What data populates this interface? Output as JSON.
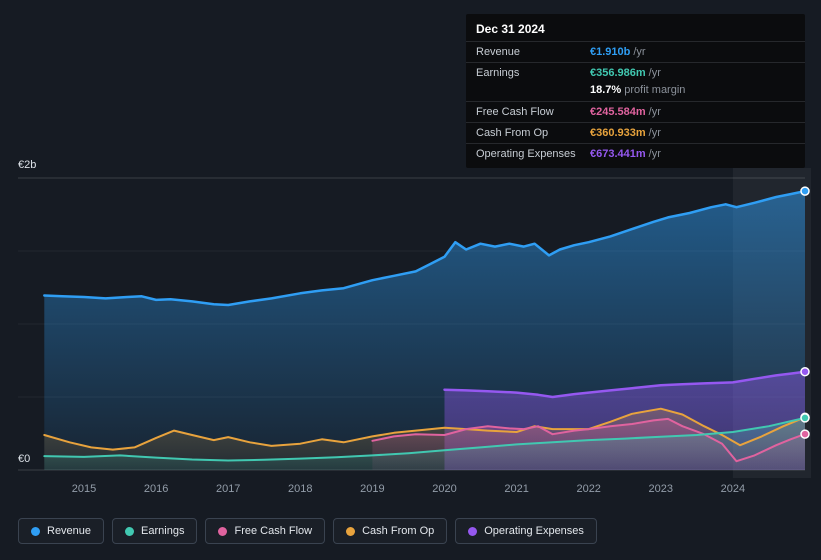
{
  "colors": {
    "revenue": "#2f9ef4",
    "earnings": "#41c8b1",
    "free_cash_flow": "#e0639f",
    "cash_from_op": "#e8a33d",
    "operating_expenses": "#9558f0"
  },
  "tooltip": {
    "title": "Dec 31 2024",
    "rows": [
      {
        "label": "Revenue",
        "value": "€1.910b",
        "unit": "/yr"
      },
      {
        "label": "Earnings",
        "value": "€356.986m",
        "unit": "/yr",
        "sub_bold": "18.7%",
        "sub_text": "profit margin"
      },
      {
        "label": "Free Cash Flow",
        "value": "€245.584m",
        "unit": "/yr"
      },
      {
        "label": "Cash From Op",
        "value": "€360.933m",
        "unit": "/yr"
      },
      {
        "label": "Operating Expenses",
        "value": "€673.441m",
        "unit": "/yr"
      }
    ]
  },
  "legend": {
    "items": [
      {
        "label": "Revenue",
        "color": "revenue"
      },
      {
        "label": "Earnings",
        "color": "earnings"
      },
      {
        "label": "Free Cash Flow",
        "color": "free_cash_flow"
      },
      {
        "label": "Cash From Op",
        "color": "cash_from_op"
      },
      {
        "label": "Operating Expenses",
        "color": "operating_expenses"
      }
    ]
  },
  "chart_data": {
    "type": "area",
    "title": "",
    "x_unit": "year",
    "x_range": [
      2014.45,
      2025.0
    ],
    "y_max": 2.0,
    "y_axis_top_label": "€2b",
    "y_axis_zero_label": "€0",
    "x_ticks": [
      2015,
      2016,
      2017,
      2018,
      2019,
      2020,
      2021,
      2022,
      2023,
      2024
    ],
    "gridlines": [
      0,
      0.5,
      1.0,
      1.5,
      2.0
    ],
    "highlight_from": 2024.0,
    "legend_position": "bottom",
    "series": [
      {
        "name": "Revenue",
        "color": "#2f9ef4",
        "width": 2.5,
        "fill_top": 0.5,
        "fill_bottom": 0.07,
        "points": [
          [
            2014.45,
            1.195
          ],
          [
            2014.7,
            1.19
          ],
          [
            2015,
            1.185
          ],
          [
            2015.3,
            1.175
          ],
          [
            2015.6,
            1.185
          ],
          [
            2015.8,
            1.19
          ],
          [
            2016,
            1.165
          ],
          [
            2016.2,
            1.17
          ],
          [
            2016.5,
            1.155
          ],
          [
            2016.8,
            1.135
          ],
          [
            2017,
            1.13
          ],
          [
            2017.3,
            1.155
          ],
          [
            2017.6,
            1.175
          ],
          [
            2018,
            1.21
          ],
          [
            2018.3,
            1.23
          ],
          [
            2018.6,
            1.245
          ],
          [
            2019,
            1.3
          ],
          [
            2019.3,
            1.33
          ],
          [
            2019.6,
            1.36
          ],
          [
            2019.8,
            1.41
          ],
          [
            2020,
            1.46
          ],
          [
            2020.15,
            1.56
          ],
          [
            2020.3,
            1.51
          ],
          [
            2020.5,
            1.55
          ],
          [
            2020.7,
            1.53
          ],
          [
            2020.9,
            1.55
          ],
          [
            2021.1,
            1.53
          ],
          [
            2021.25,
            1.55
          ],
          [
            2021.45,
            1.47
          ],
          [
            2021.6,
            1.51
          ],
          [
            2021.8,
            1.54
          ],
          [
            2022,
            1.56
          ],
          [
            2022.3,
            1.6
          ],
          [
            2022.6,
            1.65
          ],
          [
            2022.9,
            1.7
          ],
          [
            2023.1,
            1.73
          ],
          [
            2023.4,
            1.76
          ],
          [
            2023.7,
            1.8
          ],
          [
            2023.9,
            1.82
          ],
          [
            2024.05,
            1.8
          ],
          [
            2024.3,
            1.83
          ],
          [
            2024.6,
            1.87
          ],
          [
            2024.8,
            1.89
          ],
          [
            2025,
            1.91
          ]
        ]
      },
      {
        "name": "Operating Expenses",
        "color": "#9558f0",
        "width": 2.5,
        "fill_top": 0.42,
        "fill_bottom": 0.3,
        "points": [
          [
            2020,
            0.55
          ],
          [
            2020.3,
            0.545
          ],
          [
            2020.6,
            0.54
          ],
          [
            2021,
            0.53
          ],
          [
            2021.3,
            0.515
          ],
          [
            2021.5,
            0.5
          ],
          [
            2021.8,
            0.52
          ],
          [
            2022,
            0.53
          ],
          [
            2022.3,
            0.545
          ],
          [
            2022.6,
            0.56
          ],
          [
            2023,
            0.58
          ],
          [
            2023.3,
            0.587
          ],
          [
            2023.6,
            0.593
          ],
          [
            2024,
            0.6
          ],
          [
            2024.3,
            0.625
          ],
          [
            2024.6,
            0.648
          ],
          [
            2024.8,
            0.66
          ],
          [
            2025,
            0.673
          ]
        ]
      },
      {
        "name": "Cash From Op",
        "color": "#e8a33d",
        "width": 2,
        "fill_top": 0.25,
        "fill_bottom": 0.05,
        "points": [
          [
            2014.45,
            0.24
          ],
          [
            2014.8,
            0.19
          ],
          [
            2015.1,
            0.155
          ],
          [
            2015.4,
            0.14
          ],
          [
            2015.7,
            0.155
          ],
          [
            2016,
            0.22
          ],
          [
            2016.25,
            0.27
          ],
          [
            2016.5,
            0.24
          ],
          [
            2016.8,
            0.205
          ],
          [
            2017,
            0.225
          ],
          [
            2017.3,
            0.19
          ],
          [
            2017.6,
            0.165
          ],
          [
            2018,
            0.18
          ],
          [
            2018.3,
            0.21
          ],
          [
            2018.6,
            0.19
          ],
          [
            2019,
            0.23
          ],
          [
            2019.3,
            0.255
          ],
          [
            2019.6,
            0.27
          ],
          [
            2020,
            0.29
          ],
          [
            2020.3,
            0.28
          ],
          [
            2020.6,
            0.27
          ],
          [
            2021,
            0.26
          ],
          [
            2021.25,
            0.3
          ],
          [
            2021.5,
            0.28
          ],
          [
            2022,
            0.28
          ],
          [
            2022.3,
            0.33
          ],
          [
            2022.6,
            0.385
          ],
          [
            2023,
            0.42
          ],
          [
            2023.3,
            0.38
          ],
          [
            2023.6,
            0.3
          ],
          [
            2023.85,
            0.24
          ],
          [
            2024.1,
            0.17
          ],
          [
            2024.4,
            0.23
          ],
          [
            2024.7,
            0.3
          ],
          [
            2025,
            0.361
          ]
        ]
      },
      {
        "name": "Free Cash Flow",
        "color": "#e0639f",
        "width": 2,
        "fill_top": 0.28,
        "fill_bottom": 0.07,
        "points": [
          [
            2019,
            0.2
          ],
          [
            2019.3,
            0.23
          ],
          [
            2019.6,
            0.245
          ],
          [
            2020,
            0.24
          ],
          [
            2020.3,
            0.28
          ],
          [
            2020.6,
            0.3
          ],
          [
            2020.9,
            0.285
          ],
          [
            2021.1,
            0.28
          ],
          [
            2021.3,
            0.3
          ],
          [
            2021.5,
            0.245
          ],
          [
            2021.8,
            0.27
          ],
          [
            2022,
            0.28
          ],
          [
            2022.3,
            0.3
          ],
          [
            2022.6,
            0.315
          ],
          [
            2022.9,
            0.34
          ],
          [
            2023.1,
            0.35
          ],
          [
            2023.3,
            0.3
          ],
          [
            2023.6,
            0.245
          ],
          [
            2023.85,
            0.18
          ],
          [
            2024.05,
            0.06
          ],
          [
            2024.3,
            0.1
          ],
          [
            2024.6,
            0.17
          ],
          [
            2024.8,
            0.21
          ],
          [
            2025,
            0.2456
          ]
        ]
      },
      {
        "name": "Earnings",
        "color": "#41c8b1",
        "width": 2,
        "fill_top": 0.32,
        "fill_bottom": 0.1,
        "points": [
          [
            2014.45,
            0.095
          ],
          [
            2015,
            0.09
          ],
          [
            2015.5,
            0.1
          ],
          [
            2016,
            0.085
          ],
          [
            2016.5,
            0.072
          ],
          [
            2017,
            0.065
          ],
          [
            2017.5,
            0.07
          ],
          [
            2018,
            0.078
          ],
          [
            2018.5,
            0.088
          ],
          [
            2019,
            0.1
          ],
          [
            2019.5,
            0.115
          ],
          [
            2020,
            0.135
          ],
          [
            2020.5,
            0.155
          ],
          [
            2021,
            0.175
          ],
          [
            2021.5,
            0.19
          ],
          [
            2022,
            0.205
          ],
          [
            2022.5,
            0.215
          ],
          [
            2023,
            0.228
          ],
          [
            2023.5,
            0.24
          ],
          [
            2024,
            0.26
          ],
          [
            2024.5,
            0.3
          ],
          [
            2025,
            0.357
          ]
        ]
      }
    ]
  }
}
